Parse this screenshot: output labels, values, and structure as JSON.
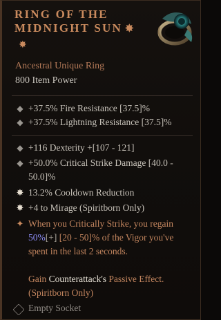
{
  "item": {
    "name": "RING OF THE MIDNIGHT SUN",
    "type": "Ancestral Unique Ring",
    "power": "800 Item Power"
  },
  "implicits": [
    {
      "text": "+37.5% Fire Resistance [37.5]%"
    },
    {
      "text": "+37.5% Lightning Resistance [37.5]%"
    }
  ],
  "affixes": [
    {
      "text": "+116 Dexterity +[107 - 121]"
    },
    {
      "line1": "+50.0% Critical Strike Damage [40.0 -",
      "line2": "50.0]%"
    },
    {
      "text": "13.2% Cooldown Reduction"
    },
    {
      "text": "+4 to Mirage (Spiritborn Only)"
    }
  ],
  "unique_power": {
    "line1": "When you Critically Strike, you regain",
    "value": "50%",
    "value_suffix": "[+]",
    "line2_rest": " [20 - 50]% of the Vigor you've",
    "line3": "spent in the last 2 seconds.",
    "gain_prefix": "Gain ",
    "gain_highlight": "Counterattack's",
    "gain_suffix": " Passive Effect.",
    "line5": "(Spiritborn Only)"
  },
  "socket": {
    "label": "Empty Socket"
  },
  "colors": {
    "unique": "#c98a5e",
    "stat": "#c7c2b9",
    "highlight": "#8c8cf5"
  }
}
